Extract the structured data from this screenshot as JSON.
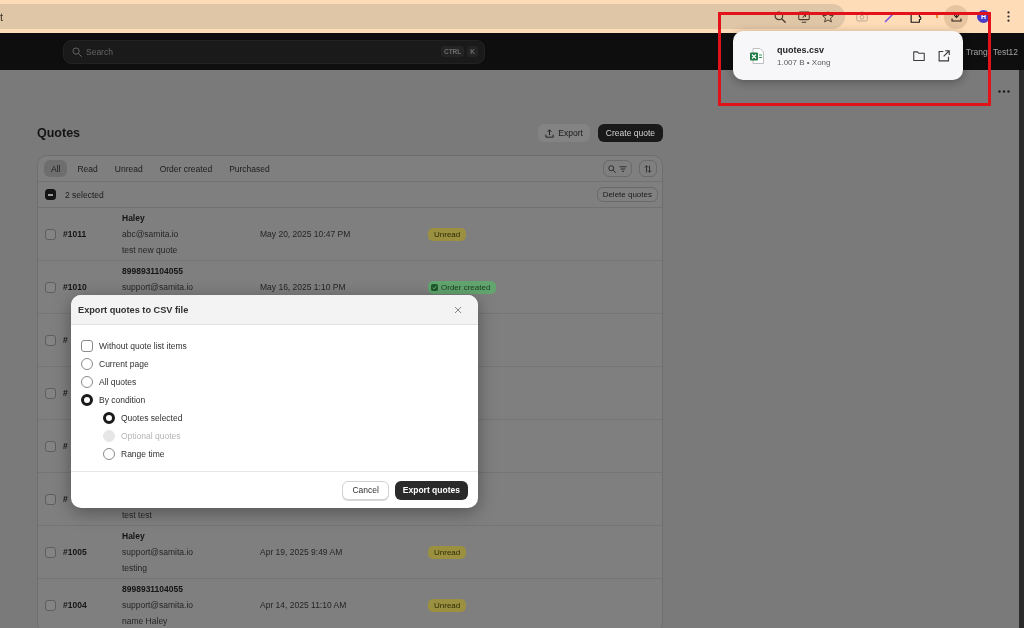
{
  "browser": {
    "address_text": "t",
    "downloads_open": true,
    "profile_initial": "H"
  },
  "download_popup": {
    "file_name": "quotes.csv",
    "details": "1.007 B • Xong"
  },
  "top_bar": {
    "search": {
      "placeholder": "Search",
      "shortcut_keys": [
        "CTRL",
        "K"
      ]
    },
    "user_name": "Trang Test12"
  },
  "page": {
    "title": "Quotes",
    "actions": [
      {
        "label": "Export",
        "kind": "secondary"
      },
      {
        "label": "Create quote",
        "kind": "primary"
      }
    ]
  },
  "quotes_table": {
    "tabs": [
      {
        "label": "All",
        "selected": true
      },
      {
        "label": "Read",
        "selected": false
      },
      {
        "label": "Unread",
        "selected": false
      },
      {
        "label": "Order created",
        "selected": false
      },
      {
        "label": "Purchased",
        "selected": false
      }
    ],
    "bulk_bar": {
      "indeterminate": true,
      "label": "2 selected",
      "action": "Delete quotes"
    },
    "rows": [
      {
        "selected": false,
        "id": "#1011",
        "name": "Haley",
        "email": "abc@samita.io",
        "note": "test new quote",
        "date": "May 20, 2025 10:47 PM",
        "status": {
          "label": "Unread",
          "kind": "unread"
        }
      },
      {
        "selected": false,
        "id": "#1010",
        "name": "8998931104055",
        "email": "support@samita.io",
        "date": "May 16, 2025 1:10 PM",
        "status": {
          "label": "Order created",
          "kind": "order_created"
        }
      },
      {
        "selected": false,
        "id": "#"
      },
      {
        "selected": false,
        "id": "#"
      },
      {
        "selected": false,
        "id": "#"
      },
      {
        "selected": false,
        "id": "#",
        "note": "test test"
      },
      {
        "selected": false,
        "id": "#1005",
        "name": "Haley",
        "email": "support@samita.io",
        "note": "testing",
        "date": "Apr 19, 2025 9:49 AM",
        "status": {
          "label": "Unread",
          "kind": "unread"
        }
      },
      {
        "selected": false,
        "id": "#1004",
        "name": "8998931104055",
        "email": "support@samita.io",
        "note": "name Haley",
        "date": "Apr 14, 2025 11:10 AM",
        "status": {
          "label": "Unread",
          "kind": "unread"
        }
      }
    ]
  },
  "export_dialog": {
    "title": "Export quotes to CSV file",
    "options": [
      {
        "kind": "checkbox",
        "label": "Without quote list items",
        "checked": false,
        "disabled": false
      },
      {
        "kind": "radio",
        "label": "Current page",
        "selected": false,
        "disabled": false
      },
      {
        "kind": "radio",
        "label": "All quotes",
        "selected": false,
        "disabled": false
      },
      {
        "kind": "radio",
        "label": "By condition",
        "selected": true,
        "disabled": false,
        "children": [
          {
            "kind": "radio",
            "label": "Quotes selected",
            "selected": true,
            "disabled": false
          },
          {
            "kind": "radio",
            "label": "Optional quotes",
            "selected": false,
            "disabled": true
          },
          {
            "kind": "radio",
            "label": "Range time",
            "selected": false,
            "disabled": false
          }
        ]
      }
    ],
    "buttons": [
      {
        "label": "Cancel",
        "kind": "secondary"
      },
      {
        "label": "Export quotes",
        "kind": "primary"
      }
    ]
  }
}
